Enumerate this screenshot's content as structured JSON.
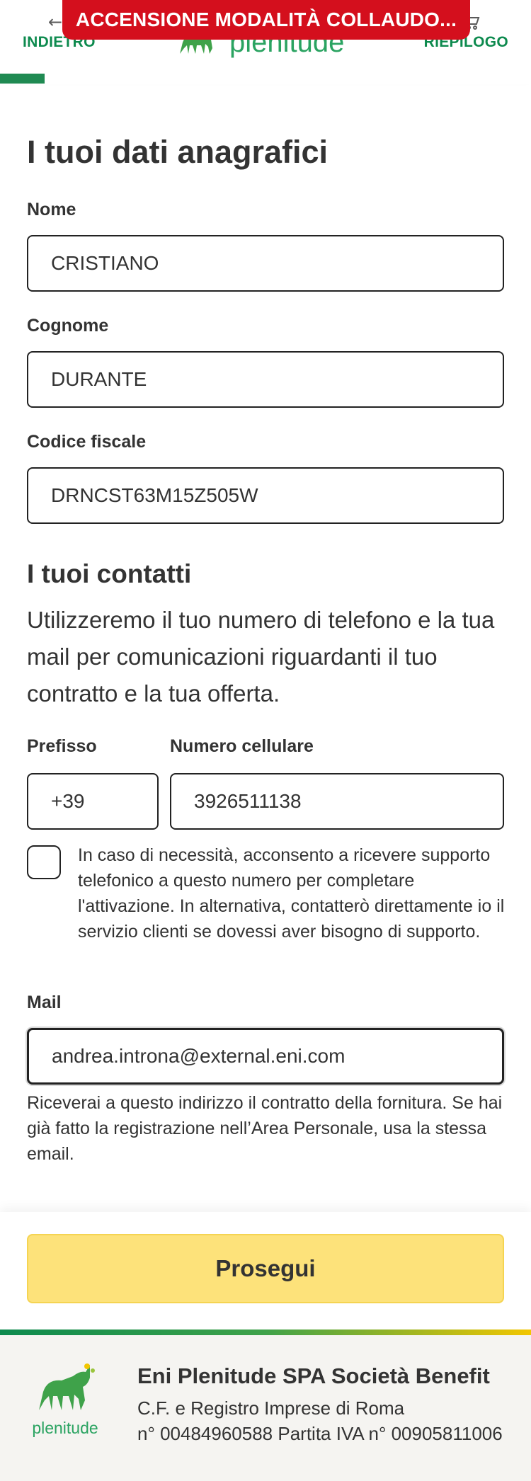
{
  "header": {
    "back_label": "INDIETRO",
    "summary_label": "RIEPILOGO",
    "brand": "plenitude",
    "test_banner": "ACCENSIONE MODALITÀ COLLAUDO...",
    "progress_fraction": 0.084
  },
  "personal": {
    "title": "I tuoi dati anagrafici",
    "name_label": "Nome",
    "name_value": "CRISTIANO",
    "surname_label": "Cognome",
    "surname_value": "DURANTE",
    "fiscal_code_label": "Codice fiscale",
    "fiscal_code_value": "DRNCST63M15Z505W"
  },
  "contacts": {
    "title": "I tuoi contatti",
    "intro": "Utilizzeremo il tuo numero di telefono e la tua mail per comunicazioni riguardanti il tuo contratto e la tua offerta.",
    "prefix_label": "Prefisso",
    "prefix_value": "+39",
    "phone_label": "Numero cellulare",
    "phone_value": "3926511138",
    "consent_text": "In caso di necessità, acconsento a ricevere supporto telefonico a questo numero per completare l'attivazione. In alternativa, contatterò direttamente io il servizio clienti se dovessi aver bisogno di supporto.",
    "consent_checked": false,
    "mail_label": "Mail",
    "mail_value": "andrea.introna@external.eni.com",
    "mail_hint": "Riceverai a questo indirizzo il contratto della fornitura. Se hai già fatto la registrazione nell’Area Personale, usa la stessa email."
  },
  "actions": {
    "continue_label": "Prosegui"
  },
  "footer": {
    "brand": "plenitude",
    "company": "Eni Plenitude SPA Società Benefit",
    "registry": "C.F. e Registro Imprese di Roma",
    "vat": "n° 00484960588 Partita IVA n° 00905811006"
  },
  "colors": {
    "brand_green": "#0d8a4e",
    "banner_red": "#d40f1d",
    "button_yellow": "#fde27a"
  },
  "icons": {
    "back": "arrow-left-icon",
    "summary": "cart-icon",
    "logo": "six-legged-dog-icon"
  }
}
